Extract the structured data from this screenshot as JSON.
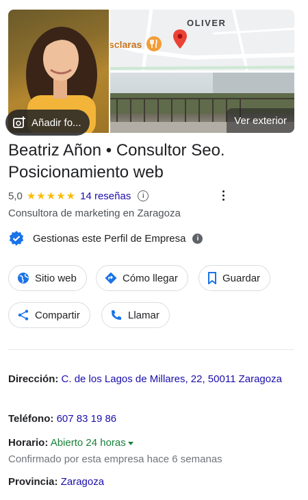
{
  "gallery": {
    "add_photo_label": "Añadir fo...",
    "map_street_label": "OLIVER",
    "map_poi_label": "sclaras",
    "exterior_label": "Ver exterior"
  },
  "business": {
    "name": "Beatriz Añon • Consultor Seo. Posicionamiento web",
    "rating": "5,0",
    "stars": "★★★★★",
    "rating_fraction": 1.0,
    "reviews_label": "14 reseñas",
    "category": "Consultora de marketing en Zaragoza",
    "managed_label": "Gestionas este Perfil de Empresa"
  },
  "actions": [
    {
      "label": "Sitio web",
      "icon": "globe-icon"
    },
    {
      "label": "Cómo llegar",
      "icon": "directions-icon"
    },
    {
      "label": "Guardar",
      "icon": "bookmark-icon"
    },
    {
      "label": "Compartir",
      "icon": "share-icon"
    },
    {
      "label": "Llamar",
      "icon": "phone-icon"
    }
  ],
  "details": {
    "address_label": "Dirección:",
    "address_value": "C. de los Lagos de Millares, 22, 50011 Zaragoza",
    "phone_label": "Teléfono:",
    "phone_value": "607 83 19 86",
    "hours_label": "Horario:",
    "hours_value": "Abierto 24 horas",
    "hours_note": "Confirmado por esta empresa hace 6 semanas",
    "province_label": "Provincia:",
    "province_value": "Zaragoza"
  },
  "colors": {
    "link": "#1a0dab",
    "open": "#188038",
    "star": "#fbbc04",
    "verified": "#1a73e8",
    "pin": "#ea4335",
    "poi": "#f29d38"
  }
}
